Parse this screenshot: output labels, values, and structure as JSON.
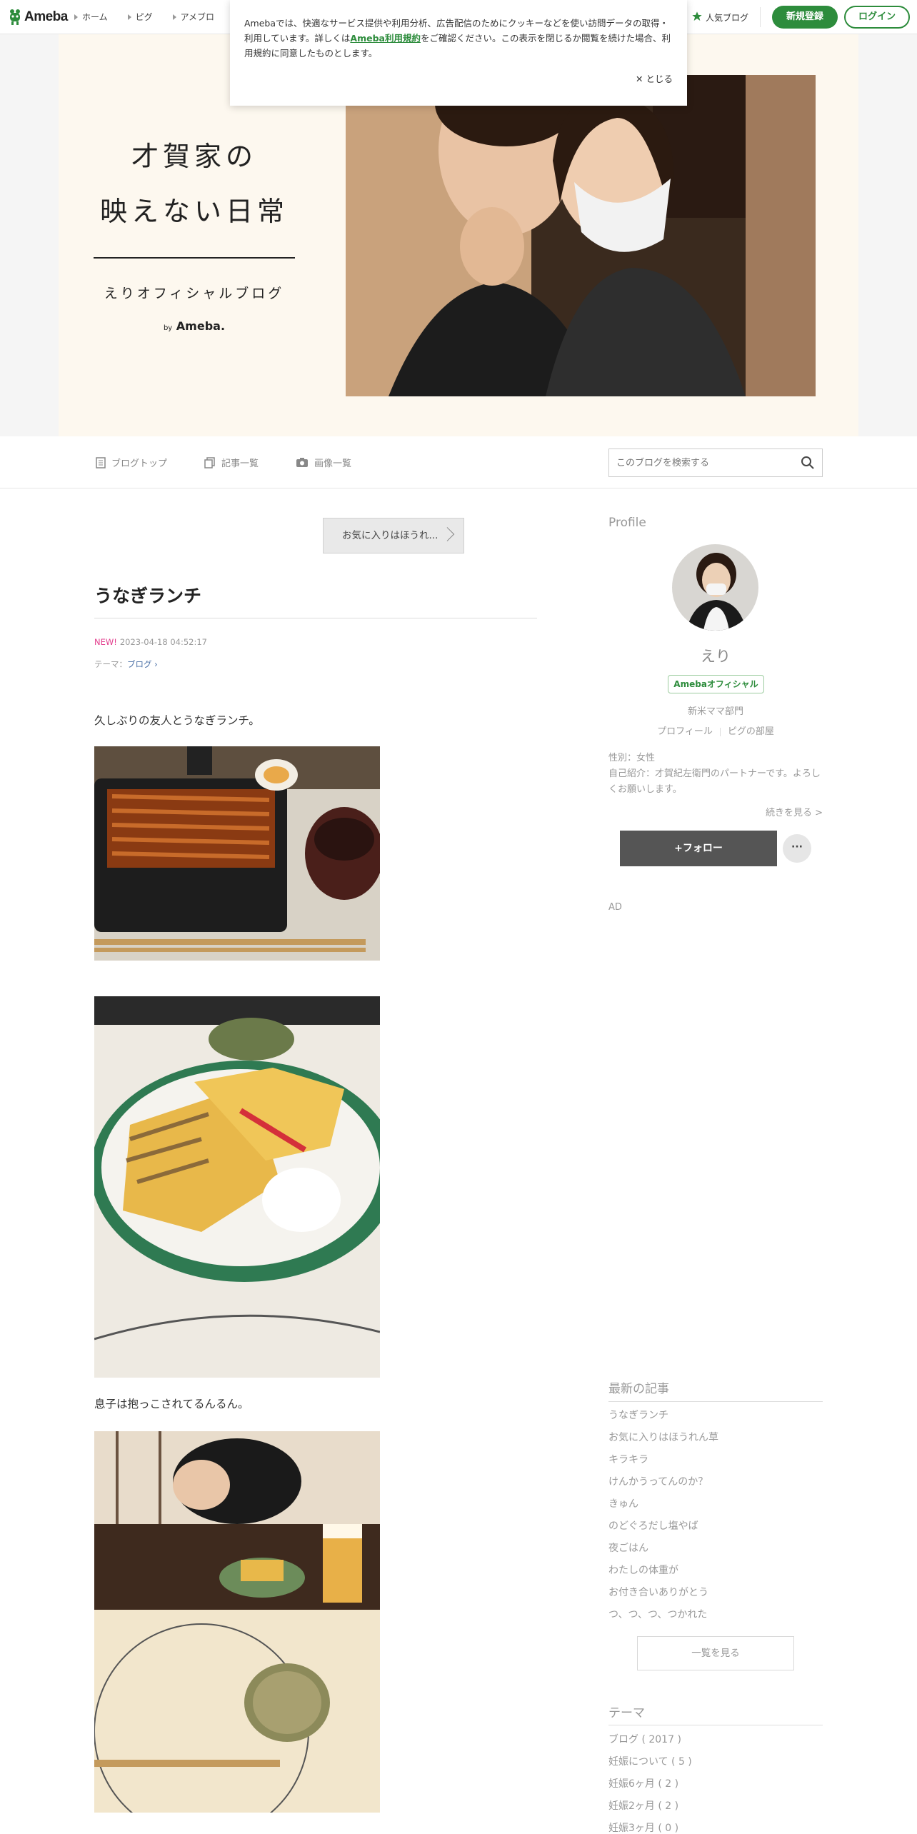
{
  "global_header": {
    "logo": "Ameba",
    "nav": [
      "ホーム",
      "ピグ",
      "アメブロ"
    ],
    "popular_blogs": "人気ブログ",
    "register_label": "新規登録",
    "login_label": "ログイン"
  },
  "cookie_banner": {
    "text_before_link": "Amebaでは、快適なサービス提供や利用分析、広告配信のためにクッキーなどを使い訪問データの取得・利用しています。詳しくは",
    "link_text": "Ameba利用規約",
    "text_after_link": "をご確認ください。この表示を閉じるか閲覧を続けた場合、利用規約に同意したものとします。",
    "close_label": "✕ とじる"
  },
  "blog_header": {
    "title_line1": "才賀家の",
    "title_line2": "映えない日常",
    "subtitle": "えりオフィシャルブログ",
    "by_prefix": "by",
    "by_brand": "Ameba."
  },
  "blog_nav": {
    "items": [
      "ブログトップ",
      "記事一覧",
      "画像一覧"
    ],
    "search_placeholder": "このブログを検索する"
  },
  "entry": {
    "favorite_button": "お気に入りはほうれ...",
    "title": "うなぎランチ",
    "new_badge": "NEW!",
    "date": "2023-04-18 04:52:17",
    "theme_prefix": "テーマ：",
    "theme_link": "ブログ",
    "paragraph1": "久しぶりの友人とうなぎランチ。",
    "paragraph2": "息子は抱っこされてるんるん。"
  },
  "profile": {
    "heading": "Profile",
    "name": "えり",
    "badge": "Amebaオフィシャル",
    "department": "新米ママ部門",
    "link_profile": "プロフィール",
    "link_room": "ピグの部屋",
    "gender": "性別：女性",
    "intro": "自己紹介：才賀紀左衛門のパートナーです。よろしくお願いします。",
    "more": "続きを見る >",
    "follow": "+フォロー",
    "more_menu": "···"
  },
  "ad_label": "AD",
  "latest": {
    "heading": "最新の記事",
    "items": [
      "うなぎランチ",
      "お気に入りはほうれん草",
      "キラキラ",
      "けんかうってんのか？",
      "きゅん",
      "のどぐろだし塩やば",
      "夜ごはん",
      "わたしの体重が",
      "お付き合いありがとう",
      "つ、つ、つ、つかれた"
    ],
    "list_button": "一覧を見る"
  },
  "themes": {
    "heading": "テーマ",
    "items": [
      "ブログ ( 2017 )",
      "妊娠について ( 5 )",
      "妊娠6ヶ月 ( 2 )",
      "妊娠2ヶ月 ( 2 )",
      "妊娠3ヶ月 ( 0 )"
    ]
  },
  "colors": {
    "brand_green": "#2d8c3c",
    "new_pink": "#e23c8c",
    "header_cream": "#fdf8ef"
  }
}
